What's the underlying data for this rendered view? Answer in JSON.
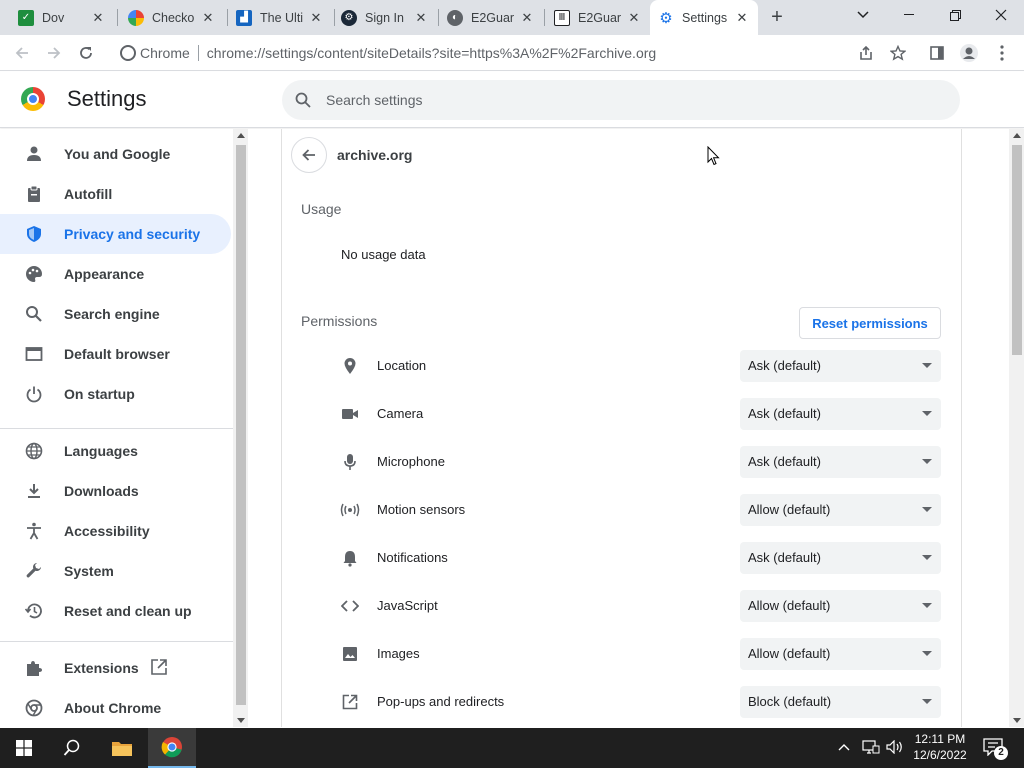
{
  "tabs": [
    {
      "title": "Dov",
      "favicon_color": "#1e8e3e"
    },
    {
      "title": "Checko",
      "favicon_color": "#e8710a"
    },
    {
      "title": "The Ulti",
      "favicon_color": "#1565c0"
    },
    {
      "title": "Sign In",
      "favicon_color": "#1b2838"
    },
    {
      "title": "E2Guar",
      "favicon_color": "#5f6368"
    },
    {
      "title": "E2Guar",
      "favicon_color": "#202124"
    },
    {
      "title": "Settings",
      "favicon_color": "#1a73e8"
    }
  ],
  "toolbar": {
    "chip": "Chrome",
    "url": "chrome://settings/content/siteDetails?site=https%3A%2F%2Farchive.org"
  },
  "header": {
    "title": "Settings",
    "search_placeholder": "Search settings"
  },
  "sidebar": {
    "items": [
      {
        "label": "You and Google",
        "icon": "person-icon"
      },
      {
        "label": "Autofill",
        "icon": "clipboard-icon"
      },
      {
        "label": "Privacy and security",
        "icon": "shield-icon"
      },
      {
        "label": "Appearance",
        "icon": "palette-icon"
      },
      {
        "label": "Search engine",
        "icon": "search-icon"
      },
      {
        "label": "Default browser",
        "icon": "browser-icon"
      },
      {
        "label": "On startup",
        "icon": "power-icon"
      },
      {
        "label": "Languages",
        "icon": "globe-icon"
      },
      {
        "label": "Downloads",
        "icon": "download-icon"
      },
      {
        "label": "Accessibility",
        "icon": "accessibility-icon"
      },
      {
        "label": "System",
        "icon": "wrench-icon"
      },
      {
        "label": "Reset and clean up",
        "icon": "history-icon"
      },
      {
        "label": "Extensions",
        "icon": "puzzle-icon"
      },
      {
        "label": "About Chrome",
        "icon": "chrome-icon"
      }
    ],
    "active": "Privacy and security"
  },
  "site": {
    "name": "archive.org",
    "usage_label": "Usage",
    "usage_value": "No usage data",
    "permissions_label": "Permissions",
    "reset_label": "Reset permissions"
  },
  "permissions": [
    {
      "label": "Location",
      "value": "Ask (default)",
      "icon": "location-pin-icon"
    },
    {
      "label": "Camera",
      "value": "Ask (default)",
      "icon": "camera-icon"
    },
    {
      "label": "Microphone",
      "value": "Ask (default)",
      "icon": "microphone-icon"
    },
    {
      "label": "Motion sensors",
      "value": "Allow (default)",
      "icon": "motion-sensors-icon"
    },
    {
      "label": "Notifications",
      "value": "Ask (default)",
      "icon": "bell-icon"
    },
    {
      "label": "JavaScript",
      "value": "Allow (default)",
      "icon": "code-icon"
    },
    {
      "label": "Images",
      "value": "Allow (default)",
      "icon": "image-icon"
    },
    {
      "label": "Pop-ups and redirects",
      "value": "Block (default)",
      "icon": "external-link-icon"
    }
  ],
  "taskbar": {
    "time": "12:11 PM",
    "date": "12/6/2022",
    "notifications_count": "2"
  },
  "colors": {
    "accent": "#1a73e8",
    "active_nav_bg": "#e8f0fe",
    "tabstrip_bg": "#dee1e6",
    "taskbar_bg": "#1f1f1f"
  }
}
